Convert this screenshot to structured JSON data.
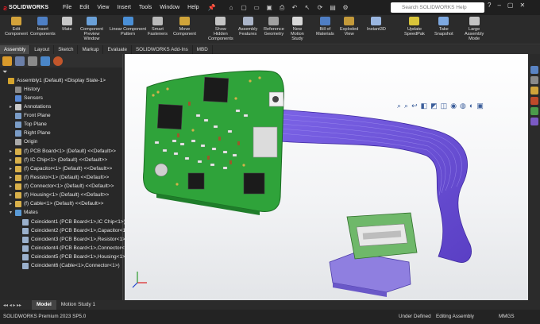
{
  "app": {
    "brand": "SOLIDWORKS",
    "product_status": "SOLIDWORKS Premium 2023 SP5.0"
  },
  "menu": [
    "File",
    "Edit",
    "View",
    "Insert",
    "Tools",
    "Window",
    "Help"
  ],
  "search": {
    "placeholder": "Search SOLIDWORKS Help"
  },
  "commands": [
    {
      "label": "Edit\nComponent",
      "icon": "edit-component-icon"
    },
    {
      "label": "Insert\nComponents",
      "icon": "insert-components-icon"
    },
    {
      "label": "Mate",
      "icon": "mate-icon"
    },
    {
      "label": "Component\nPreview\nWindow",
      "icon": "preview-window-icon"
    },
    {
      "label": "Linear Component\nPattern",
      "icon": "linear-pattern-icon"
    },
    {
      "label": "Smart\nFasteners",
      "icon": "smart-fasteners-icon"
    },
    {
      "label": "Move\nComponent",
      "icon": "move-component-icon"
    },
    {
      "label": "Show\nHidden\nComponents",
      "icon": "show-hidden-icon"
    },
    {
      "label": "Assembly\nFeatures",
      "icon": "assembly-features-icon"
    },
    {
      "label": "Reference\nGeometry",
      "icon": "reference-geometry-icon"
    },
    {
      "label": "New\nMotion\nStudy",
      "icon": "motion-study-icon"
    },
    {
      "label": "Bill of\nMaterials",
      "icon": "bom-icon"
    },
    {
      "label": "Exploded\nView",
      "icon": "exploded-view-icon"
    },
    {
      "label": "Instant3D",
      "icon": "instant3d-icon"
    },
    {
      "label": "Update\nSpeedPak",
      "icon": "speedpak-icon"
    },
    {
      "label": "Take\nSnapshot",
      "icon": "snapshot-icon"
    },
    {
      "label": "Large\nAssembly\nMode",
      "icon": "large-assembly-icon"
    }
  ],
  "tabs": [
    "Assembly",
    "Layout",
    "Sketch",
    "Markup",
    "Evaluate",
    "SOLIDWORKS Add-Ins",
    "MBD"
  ],
  "active_tab": "Assembly",
  "tree": {
    "root": "Assembly1 (Default) <Display State-1>",
    "items": [
      {
        "label": "History",
        "icon": "history-icon",
        "indent": 1,
        "expand": ""
      },
      {
        "label": "Sensors",
        "icon": "sensors-icon",
        "indent": 1,
        "expand": ""
      },
      {
        "label": "Annotations",
        "icon": "annotations-icon",
        "indent": 1,
        "expand": "▸"
      },
      {
        "label": "Front Plane",
        "icon": "plane-icon",
        "indent": 1,
        "expand": ""
      },
      {
        "label": "Top Plane",
        "icon": "plane-icon",
        "indent": 1,
        "expand": ""
      },
      {
        "label": "Right Plane",
        "icon": "plane-icon",
        "indent": 1,
        "expand": ""
      },
      {
        "label": "Origin",
        "icon": "origin-icon",
        "indent": 1,
        "expand": ""
      },
      {
        "label": "(f) PCB Board<1> (Default) <<Default>>",
        "icon": "part-icon",
        "indent": 1,
        "expand": "▸"
      },
      {
        "label": "(f) IC Chip<1> (Default) <<Default>>",
        "icon": "part-icon",
        "indent": 1,
        "expand": "▸"
      },
      {
        "label": "(f) Capacitor<1> (Default) <<Default>>",
        "icon": "part-icon",
        "indent": 1,
        "expand": "▸"
      },
      {
        "label": "(f) Resistor<1> (Default) <<Default>>",
        "icon": "part-icon",
        "indent": 1,
        "expand": "▸"
      },
      {
        "label": "(f) Connector<1> (Default) <<Default>>",
        "icon": "part-icon",
        "indent": 1,
        "expand": "▸"
      },
      {
        "label": "(f) Housing<1> (Default) <<Default>>",
        "icon": "part-icon",
        "indent": 1,
        "expand": "▸"
      },
      {
        "label": "(f) Cable<1> (Default) <<Default>>",
        "icon": "part-icon",
        "indent": 1,
        "expand": "▸"
      },
      {
        "label": "Mates",
        "icon": "mates-icon",
        "indent": 1,
        "expand": "▾"
      },
      {
        "label": "Coincident1 (PCB Board<1>,IC Chip<1>)",
        "icon": "coincident-icon",
        "indent": 2,
        "expand": ""
      },
      {
        "label": "Coincident2 (PCB Board<1>,Capacitor<1>)",
        "icon": "coincident-icon",
        "indent": 2,
        "expand": ""
      },
      {
        "label": "Coincident3 (PCB Board<1>,Resistor<1>)",
        "icon": "coincident-icon",
        "indent": 2,
        "expand": ""
      },
      {
        "label": "Coincident4 (PCB Board<1>,Connector<1>)",
        "icon": "coincident-icon",
        "indent": 2,
        "expand": ""
      },
      {
        "label": "Coincident5 (PCB Board<1>,Housing<1>)",
        "icon": "coincident-icon",
        "indent": 2,
        "expand": ""
      },
      {
        "label": "Coincident6 (Cable<1>,Connector<1>)",
        "icon": "coincident-icon",
        "indent": 2,
        "expand": ""
      }
    ]
  },
  "bottom_tabs": [
    "Model",
    "Motion Study 1"
  ],
  "status": {
    "left": "SOLIDWORKS Premium 2023 SP5.0",
    "definition": "Under Defined",
    "mode": "Editing Assembly",
    "units": "MMGS"
  },
  "colors": {
    "pcb": "#2fa33a",
    "pcb_dark": "#1f7d2a",
    "cable": "#6a4fd6",
    "housing": "#8f7fe0",
    "connector": "#6fb86a",
    "brand_red": "#e31b23",
    "background": "#2b2b2b"
  }
}
